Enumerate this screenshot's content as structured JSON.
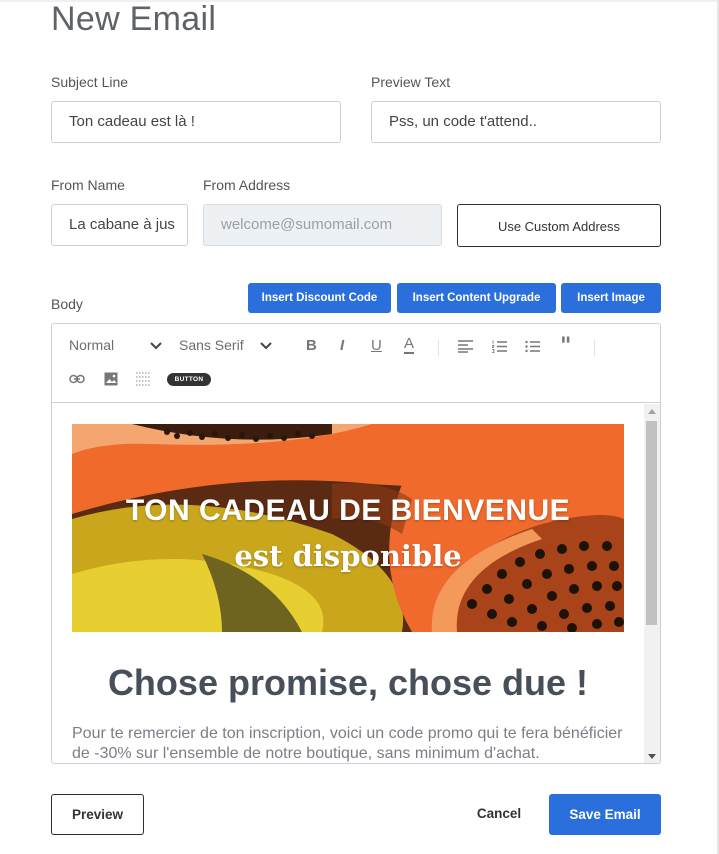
{
  "page": {
    "title": "New Email"
  },
  "form": {
    "subject": {
      "label": "Subject Line",
      "value": "Ton cadeau est là !"
    },
    "preview_text": {
      "label": "Preview Text",
      "value": "Pss, un code t'attend.."
    },
    "from_name": {
      "label": "From Name",
      "value": "La cabane à jus"
    },
    "from_address": {
      "label": "From Address",
      "value": "welcome@sumomail.com"
    },
    "custom_address_button": "Use Custom Address",
    "body_label": "Body"
  },
  "insert_buttons": {
    "discount": "Insert Discount Code",
    "content_upgrade": "Insert Content Upgrade",
    "image": "Insert Image"
  },
  "toolbar": {
    "format": "Normal",
    "font": "Sans Serif",
    "button_label": "BUTTON",
    "icons": [
      "bold-icon",
      "italic-icon",
      "underline-icon",
      "text-color-icon",
      "align-icon",
      "ordered-list-icon",
      "bullet-list-icon",
      "blockquote-icon",
      "link-icon",
      "image-icon",
      "divider-icon"
    ]
  },
  "email_body": {
    "hero_title": "TON CADEAU DE BIENVENUE",
    "hero_subtitle": "est disponible",
    "headline": "Chose promise, chose due !",
    "paragraph": "Pour te remercier de ton inscription, voici un code promo qui te fera bénéficier de -30% sur l'ensemble de notre boutique, sans minimum d'achat."
  },
  "footer": {
    "preview": "Preview",
    "cancel": "Cancel",
    "save": "Save Email"
  },
  "colors": {
    "primary": "#2a6fdb",
    "hero_orange": "#f0602a",
    "hero_yellow": "#e0c020",
    "headline": "#474f5a"
  }
}
